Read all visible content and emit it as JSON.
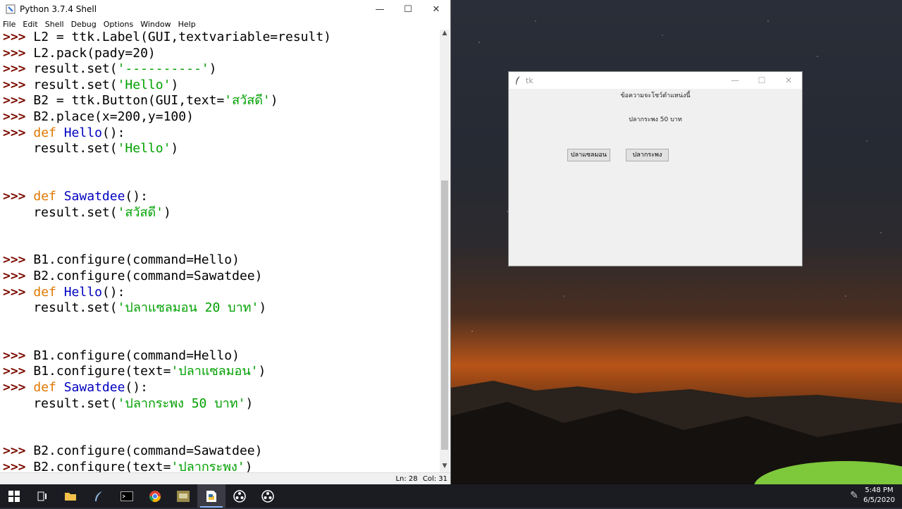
{
  "idle": {
    "title": "Python 3.7.4 Shell",
    "window_controls": {
      "minimize": "—",
      "maximize": "☐",
      "close": "✕"
    },
    "menu": [
      "File",
      "Edit",
      "Shell",
      "Debug",
      "Options",
      "Window",
      "Help"
    ],
    "lines": [
      {
        "t": "p",
        "segs": [
          [
            "p",
            ">>> "
          ],
          [
            "n",
            "L2 = ttk.Label(GUI,textvariable=result)"
          ]
        ]
      },
      {
        "t": "p",
        "segs": [
          [
            "p",
            ">>> "
          ],
          [
            "n",
            "L2.pack(pady=20)"
          ]
        ]
      },
      {
        "t": "p",
        "segs": [
          [
            "p",
            ">>> "
          ],
          [
            "n",
            "result.set("
          ],
          [
            "st",
            "'----------'"
          ],
          [
            "n",
            ")"
          ]
        ]
      },
      {
        "t": "p",
        "segs": [
          [
            "p",
            ">>> "
          ],
          [
            "n",
            "result.set("
          ],
          [
            "st",
            "'Hello'"
          ],
          [
            "n",
            ")"
          ]
        ]
      },
      {
        "t": "p",
        "segs": [
          [
            "p",
            ">>> "
          ],
          [
            "n",
            "B2 = ttk.Button(GUI,text="
          ],
          [
            "st",
            "'สวัสดี'"
          ],
          [
            "n",
            ")"
          ]
        ]
      },
      {
        "t": "p",
        "segs": [
          [
            "p",
            ">>> "
          ],
          [
            "n",
            "B2.place(x=200,y=100)"
          ]
        ]
      },
      {
        "t": "p",
        "segs": [
          [
            "p",
            ">>> "
          ],
          [
            "kw",
            "def "
          ],
          [
            "fn",
            "Hello"
          ],
          [
            "n",
            "():"
          ]
        ]
      },
      {
        "t": "p",
        "segs": [
          [
            "n",
            "    result.set("
          ],
          [
            "st",
            "'Hello'"
          ],
          [
            "n",
            ")"
          ]
        ]
      },
      {
        "t": "p",
        "segs": []
      },
      {
        "t": "p",
        "segs": []
      },
      {
        "t": "p",
        "segs": [
          [
            "p",
            ">>> "
          ],
          [
            "kw",
            "def "
          ],
          [
            "fn",
            "Sawatdee"
          ],
          [
            "n",
            "():"
          ]
        ]
      },
      {
        "t": "p",
        "segs": [
          [
            "n",
            "    result.set("
          ],
          [
            "st",
            "'สวัสดี'"
          ],
          [
            "n",
            ")"
          ]
        ]
      },
      {
        "t": "p",
        "segs": []
      },
      {
        "t": "p",
        "segs": []
      },
      {
        "t": "p",
        "segs": [
          [
            "p",
            ">>> "
          ],
          [
            "n",
            "B1.configure(command=Hello)"
          ]
        ]
      },
      {
        "t": "p",
        "segs": [
          [
            "p",
            ">>> "
          ],
          [
            "n",
            "B2.configure(command=Sawatdee)"
          ]
        ]
      },
      {
        "t": "p",
        "segs": [
          [
            "p",
            ">>> "
          ],
          [
            "kw",
            "def "
          ],
          [
            "fn",
            "Hello"
          ],
          [
            "n",
            "():"
          ]
        ]
      },
      {
        "t": "p",
        "segs": [
          [
            "n",
            "    result.set("
          ],
          [
            "st",
            "'ปลาแซลมอน 20 บาท'"
          ],
          [
            "n",
            ")"
          ]
        ]
      },
      {
        "t": "p",
        "segs": []
      },
      {
        "t": "p",
        "segs": []
      },
      {
        "t": "p",
        "segs": [
          [
            "p",
            ">>> "
          ],
          [
            "n",
            "B1.configure(command=Hello)"
          ]
        ]
      },
      {
        "t": "p",
        "segs": [
          [
            "p",
            ">>> "
          ],
          [
            "n",
            "B1.configure(text="
          ],
          [
            "st",
            "'ปลาแซลมอน'"
          ],
          [
            "n",
            ")"
          ]
        ]
      },
      {
        "t": "p",
        "segs": [
          [
            "p",
            ">>> "
          ],
          [
            "kw",
            "def "
          ],
          [
            "fn",
            "Sawatdee"
          ],
          [
            "n",
            "():"
          ]
        ]
      },
      {
        "t": "p",
        "segs": [
          [
            "n",
            "    result.set("
          ],
          [
            "st",
            "'ปลากระพง 50 บาท'"
          ],
          [
            "n",
            ")"
          ]
        ]
      },
      {
        "t": "p",
        "segs": []
      },
      {
        "t": "p",
        "segs": []
      },
      {
        "t": "p",
        "segs": [
          [
            "p",
            ">>> "
          ],
          [
            "n",
            "B2.configure(command=Sawatdee)"
          ]
        ]
      },
      {
        "t": "p",
        "segs": [
          [
            "p",
            ">>> "
          ],
          [
            "n",
            "B2.configure(text="
          ],
          [
            "st",
            "'ปลากระพง'"
          ],
          [
            "n",
            ")"
          ]
        ]
      }
    ],
    "status": {
      "ln": "Ln: 28",
      "col": "Col: 31"
    }
  },
  "tk": {
    "title": "tk",
    "header_label": "ข้อความจะโชว์ตำแหน่งนี้",
    "result_label": "ปลากระพง 50 บาท",
    "button1": "ปลาแซลมอน",
    "button2": "ปลากระพง"
  },
  "taskbar": {
    "icons": [
      "windows-start-icon",
      "task-view-icon",
      "file-explorer-icon",
      "python-idle-feather-icon",
      "terminal-icon",
      "chrome-icon",
      "app-icon",
      "python-file-icon",
      "obs-icon",
      "obs-icon-2"
    ],
    "time": "5:48 PM",
    "date": "6/5/2020"
  }
}
